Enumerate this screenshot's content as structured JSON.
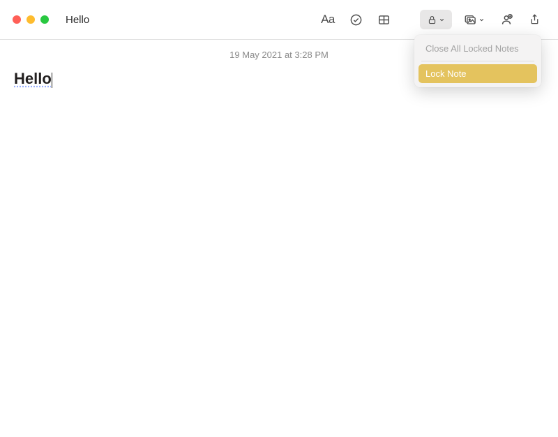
{
  "window": {
    "title": "Hello"
  },
  "toolbar": {
    "format_label": "Aa"
  },
  "note": {
    "timestamp": "19 May 2021 at 3:28 PM",
    "body": "Hello"
  },
  "dropdown": {
    "close_all": "Close All Locked Notes",
    "lock_note": "Lock Note"
  }
}
